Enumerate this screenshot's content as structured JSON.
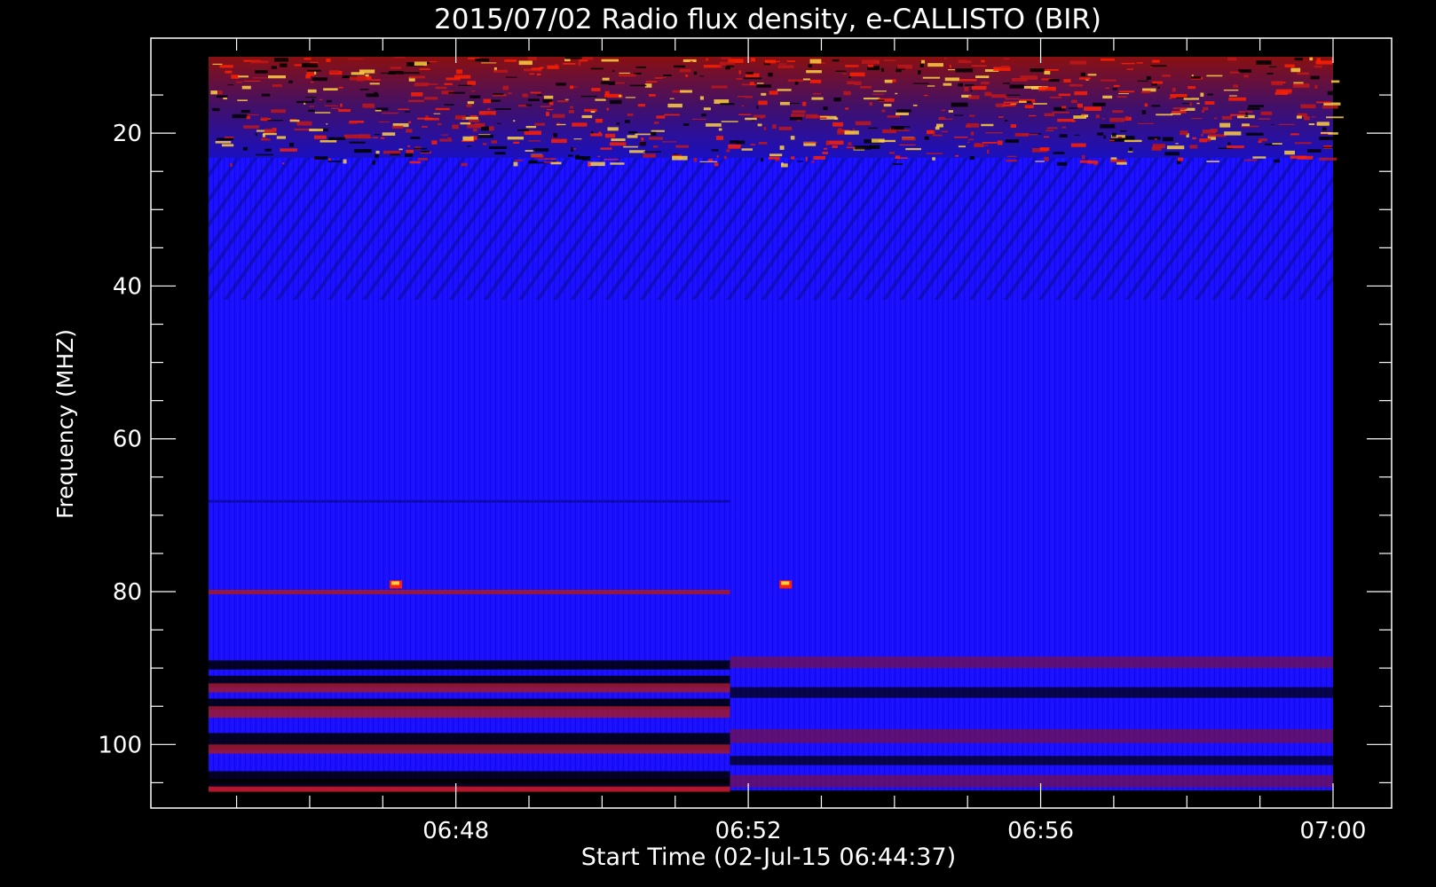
{
  "chart_data": {
    "type": "heatmap",
    "title": "2015/07/02  Radio flux density, e-CALLISTO (BIR)",
    "xlabel": "Start Time (02-Jul-15 06:44:37)",
    "ylabel": "Frequency (MHZ)",
    "x_ticks": [
      "06:48",
      "06:52",
      "06:56",
      "07:00"
    ],
    "y_ticks": [
      "20",
      "40",
      "60",
      "80",
      "100"
    ],
    "x_range": [
      "06:44:37",
      "07:00:00"
    ],
    "ylim": [
      10,
      106
    ],
    "y_inverted": true,
    "colormap": {
      "low": "#000000",
      "mid": "#1a10ff",
      "high": "#ff2000",
      "peak": "#ffd040"
    },
    "features": [
      {
        "kind": "intense burst band",
        "freq_mhz": [
          10,
          24
        ],
        "time": [
          "06:44:37",
          "07:00:00"
        ]
      },
      {
        "kind": "interference line",
        "freq_mhz": 80,
        "time": [
          "06:44:37",
          "06:51:45"
        ]
      },
      {
        "kind": "bright spot",
        "freq_mhz": 79,
        "time": "06:47:10"
      },
      {
        "kind": "bright spot",
        "freq_mhz": 79,
        "time": "06:52:30"
      },
      {
        "kind": "banded RFI",
        "freq_mhz": [
          88,
          106
        ],
        "time": [
          "06:44:37",
          "07:00:00"
        ]
      }
    ]
  }
}
